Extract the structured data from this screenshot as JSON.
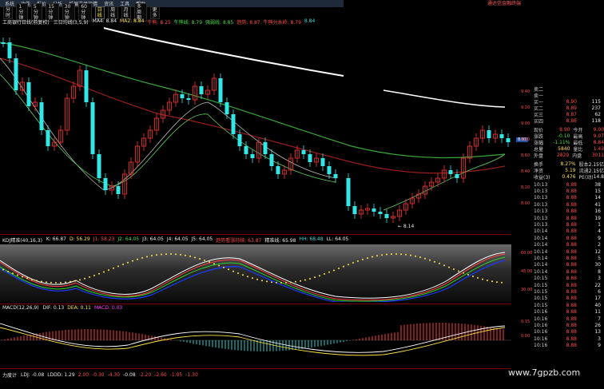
{
  "topbar": {
    "menus": [
      "系统",
      "功能",
      "报价",
      "分析",
      "扩展市场行情",
      "资讯",
      "工具",
      "帮助"
    ],
    "right_title": "通达信金融终端"
  },
  "periods": {
    "items": [
      "分时",
      "1分钟",
      "5分钟",
      "15分钟",
      "30分钟",
      "60分钟",
      "日线",
      "周线",
      "月线",
      "多周期",
      "更多"
    ],
    "active_index": 6
  },
  "ma_legend": {
    "name": "工商银行日线(前复权)",
    "indicator": "三日均线(3,5,9)",
    "items": [
      {
        "text": "MA4: 8.84",
        "color": "#e8e8e8"
      },
      {
        "text": "MA2: 8.84",
        "color": "#ffe24a"
      },
      {
        "text": "牛熊: 8.25",
        "color": "#ff4a4a"
      },
      {
        "text": "牛熊线: 8.79",
        "color": "#4ddc4d"
      },
      {
        "text": "强弱线: 8.85",
        "color": "#4ddc4d"
      },
      {
        "text": "趋势: 8.87",
        "color": "#ff4a4a"
      },
      {
        "text": "牛熊分水岭: 8.79",
        "color": "#ff4a4a"
      },
      {
        "text": "8.84",
        "color": "#38d6d6"
      }
    ]
  },
  "main_axis": [
    "9.40",
    "9.20",
    "9.00",
    "8.80",
    "8.60",
    "8.40",
    "8.20",
    "8.00"
  ],
  "low_marker": "8.14",
  "current_price_tag": "8.91",
  "kdj_legend": {
    "name": "KDJ精准(40,16,3)",
    "items": [
      {
        "text": "K: 66.87",
        "color": "#e8e8e8"
      },
      {
        "text": "D: 56.29",
        "color": "#ffe24a"
      },
      {
        "text": "J1: 58.23",
        "color": "#ff4a4a"
      },
      {
        "text": "J2: 64.05",
        "color": "#4ddc4d"
      },
      {
        "text": "J3: 64.05",
        "color": "#e8e8e8"
      },
      {
        "text": "J4: 64.05",
        "color": "#e8e8e8"
      },
      {
        "text": "J5: 64.05",
        "color": "#e8e8e8"
      },
      {
        "text": "趋势看涨持续: 63.87",
        "color": "#ff4a4a"
      },
      {
        "text": "精准线: 65.98",
        "color": "#e8e8e8"
      },
      {
        "text": "HH: 68.48",
        "color": "#38d6d6"
      },
      {
        "text": "LL: 64.05",
        "color": "#e8e8e8"
      }
    ]
  },
  "kdj_axis": [
    "60.00",
    "45.00",
    "30.00"
  ],
  "macd_legend": {
    "name": "MACD(12,26,9)",
    "items": [
      {
        "text": "DIF: 0.13",
        "color": "#e8e8e8"
      },
      {
        "text": "DEA: 0.11",
        "color": "#ffe24a"
      },
      {
        "text": "MACD: 0.03",
        "color": "#ff40ff"
      }
    ]
  },
  "macd_axis": [
    "0.15",
    "0.00"
  ],
  "power_legend": {
    "name": "力度计",
    "items": [
      {
        "text": "LDJ: -0.08",
        "color": "#e8e8e8"
      },
      {
        "text": "LDDD: 1.29",
        "color": "#e8e8e8"
      },
      {
        "text": "2.00",
        "color": "#ff4a4a"
      },
      {
        "text": "-0.30",
        "color": "#ff4a4a"
      },
      {
        "text": "-4.30",
        "color": "#ff4a4a"
      },
      {
        "text": "-0.08",
        "color": "#e8e8e8"
      },
      {
        "text": "-2.20",
        "color": "#ff4a4a"
      },
      {
        "text": "-2.60",
        "color": "#ff4a4a"
      },
      {
        "text": "-1.05",
        "color": "#ff4a4a"
      },
      {
        "text": "-1.30",
        "color": "#ff4a4a"
      }
    ]
  },
  "quote": {
    "orders": [
      {
        "label": "卖二",
        "price": "",
        "vol": ""
      },
      {
        "label": "卖一",
        "price": "",
        "vol": ""
      },
      {
        "label": "买一",
        "price": "8.90",
        "vol": "115"
      },
      {
        "label": "买二",
        "price": "8.89",
        "vol": "237"
      },
      {
        "label": "买三",
        "price": "8.87",
        "vol": "62"
      },
      {
        "label": "买四",
        "price": "8.86",
        "vol": "118"
      }
    ],
    "stats": [
      {
        "a": "现价",
        "b": "8.90",
        "bc": "red",
        "c": "今开",
        "cc": "wht"
      },
      {
        "a": "涨跌",
        "b": "-0.10",
        "bc": "grn",
        "c": "最高",
        "cc": "wht"
      },
      {
        "a": "涨幅",
        "b": "-1.11%",
        "bc": "grn",
        "c": "最低",
        "cc": "wht"
      },
      {
        "a": "总量",
        "b": "5840",
        "bc": "yel",
        "c": "量比",
        "cc": "wht"
      },
      {
        "a": "外盘",
        "b": "2829",
        "bc": "red",
        "c": "内盘",
        "cc": "wht"
      }
    ],
    "stats2": [
      {
        "a": "换手",
        "b": "8.27%",
        "c": "股本",
        "d": "2.15亿"
      },
      {
        "a": "净资",
        "b": "5.19",
        "c": "流通",
        "d": "2.15亿"
      },
      {
        "a": "收益(3)",
        "b": "0.476",
        "c": "PE(动)",
        "d": "14.8"
      }
    ],
    "right_col": [
      "9.00",
      "9.07",
      "8.84",
      "1.43",
      "3011"
    ],
    "ticks": [
      {
        "t": "10:13",
        "p": "8.88",
        "v": "38"
      },
      {
        "t": "10:13",
        "p": "8.88",
        "v": "15"
      },
      {
        "t": "10:13",
        "p": "8.88",
        "v": "14"
      },
      {
        "t": "10:13",
        "p": "8.88",
        "v": "41"
      },
      {
        "t": "10:13",
        "p": "8.88",
        "v": "16"
      },
      {
        "t": "10:13",
        "p": "8.88",
        "v": "19"
      },
      {
        "t": "10:13",
        "p": "8.88",
        "v": "1"
      },
      {
        "t": "10:14",
        "p": "8.88",
        "v": "4"
      },
      {
        "t": "10:14",
        "p": "8.88",
        "v": "9"
      },
      {
        "t": "10:14",
        "p": "8.88",
        "v": "2"
      },
      {
        "t": "10:14",
        "p": "8.88",
        "v": "12"
      },
      {
        "t": "10:14",
        "p": "8.88",
        "v": "5"
      },
      {
        "t": "10:14",
        "p": "8.88",
        "v": "30"
      },
      {
        "t": "10:14",
        "p": "8.88",
        "v": "8"
      },
      {
        "t": "10:15",
        "p": "8.88",
        "v": "3"
      },
      {
        "t": "10:15",
        "p": "8.88",
        "v": "22"
      },
      {
        "t": "10:15",
        "p": "8.88",
        "v": "6"
      },
      {
        "t": "10:15",
        "p": "8.88",
        "v": "17"
      },
      {
        "t": "10:15",
        "p": "8.88",
        "v": "40"
      },
      {
        "t": "10:16",
        "p": "8.88",
        "v": "11"
      },
      {
        "t": "10:16",
        "p": "8.88",
        "v": "7"
      },
      {
        "t": "10:16",
        "p": "8.88",
        "v": "26"
      },
      {
        "t": "10:16",
        "p": "8.88",
        "v": "13"
      },
      {
        "t": "10:16",
        "p": "8.88",
        "v": "3"
      },
      {
        "t": "10:16",
        "p": "8.88",
        "v": "9"
      }
    ]
  },
  "watermark": "www.7gpzb.com",
  "colors": {
    "up": "#ff3030",
    "down": "#30e8e8",
    "ma_white": "#ffffff",
    "ma_green": "#3aa53a",
    "ma_red": "#9a1d1d"
  }
}
